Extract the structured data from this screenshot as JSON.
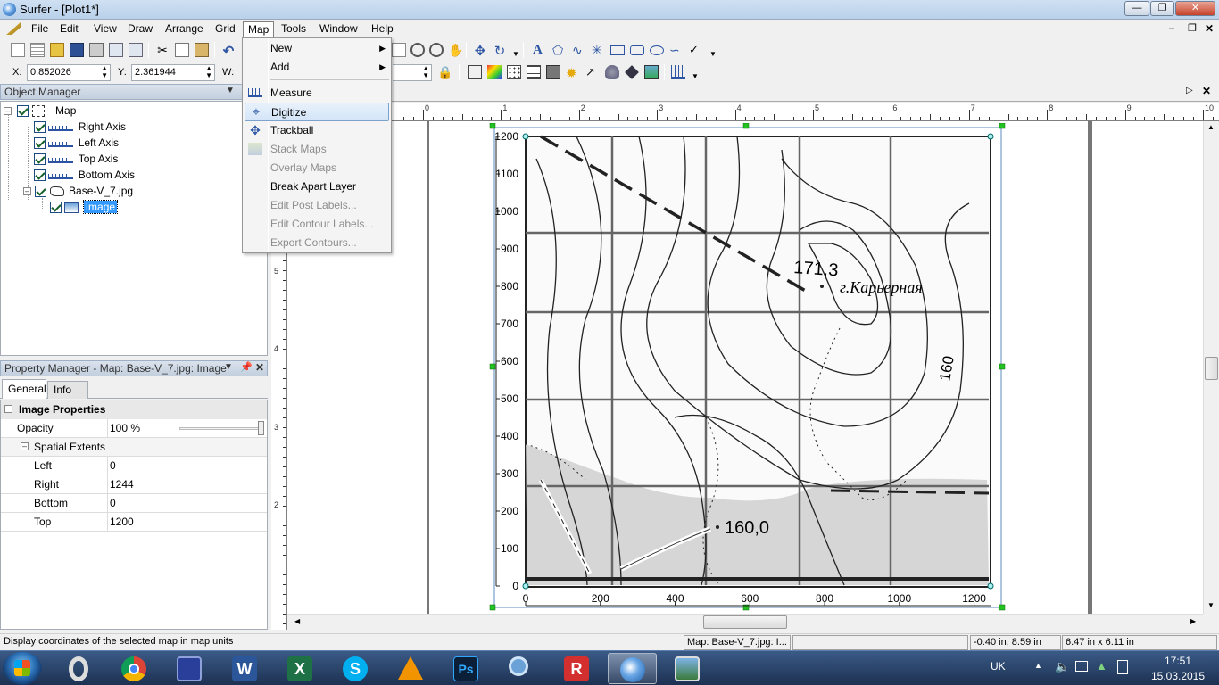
{
  "window": {
    "title": "Surfer - [Plot1*]"
  },
  "menubar": {
    "items": [
      "File",
      "Edit",
      "View",
      "Draw",
      "Arrange",
      "Grid",
      "Map",
      "Tools",
      "Window",
      "Help"
    ],
    "open": "Map"
  },
  "map_menu": {
    "items": [
      {
        "label": "New",
        "submenu": true,
        "enabled": true
      },
      {
        "label": "Add",
        "submenu": true,
        "enabled": true
      },
      {
        "label": "Measure",
        "enabled": true
      },
      {
        "label": "Digitize",
        "enabled": true,
        "highlighted": true
      },
      {
        "label": "Trackball",
        "enabled": true
      },
      {
        "label": "Stack Maps",
        "enabled": false
      },
      {
        "label": "Overlay Maps",
        "enabled": false
      },
      {
        "label": "Break Apart Layer",
        "enabled": true
      },
      {
        "label": "Edit Post Labels...",
        "enabled": false
      },
      {
        "label": "Edit Contour Labels...",
        "enabled": false
      },
      {
        "label": "Export Contours...",
        "enabled": false
      }
    ]
  },
  "coords": {
    "x_label": "X:",
    "x_value": "0.852026",
    "y_label": "Y:",
    "y_value": "2.361944",
    "w_label": "W:"
  },
  "object_manager": {
    "title": "Object Manager",
    "tree": [
      {
        "label": "Map",
        "level": 0,
        "icon": "map-icon"
      },
      {
        "label": "Right Axis",
        "level": 1,
        "icon": "axis-icon"
      },
      {
        "label": "Left Axis",
        "level": 1,
        "icon": "axis-icon"
      },
      {
        "label": "Top Axis",
        "level": 1,
        "icon": "axis-icon"
      },
      {
        "label": "Bottom Axis",
        "level": 1,
        "icon": "axis-icon"
      },
      {
        "label": "Base-V_7.jpg",
        "level": 1,
        "icon": "base-map-icon"
      },
      {
        "label": "Image",
        "level": 2,
        "icon": "image-icon",
        "selected": true
      }
    ]
  },
  "property_manager": {
    "title": "Property Manager - Map: Base-V_7.jpg: Image",
    "tabs": [
      "General",
      "Info"
    ],
    "section": "Image Properties",
    "opacity_label": "Opacity",
    "opacity_value": "100 %",
    "opacity_fraction": 1.0,
    "subsection": "Spatial Extents",
    "rows": [
      {
        "key": "Left",
        "value": "0"
      },
      {
        "key": "Right",
        "value": "1244"
      },
      {
        "key": "Bottom",
        "value": "0"
      },
      {
        "key": "Top",
        "value": "1200"
      }
    ]
  },
  "ruler": {
    "top_ticks": [
      "0",
      "1",
      "2",
      "3",
      "4",
      "5",
      "6",
      "7",
      "8",
      "9",
      "10"
    ],
    "left_ticks": [
      "6",
      "5",
      "4",
      "3",
      "2"
    ]
  },
  "plot": {
    "y_ticks": [
      "1200",
      "1100",
      "1000",
      "900",
      "800",
      "700",
      "600",
      "500",
      "400",
      "300",
      "200",
      "100",
      "0"
    ],
    "x_ticks": [
      "0",
      "200",
      "400",
      "600",
      "800",
      "1000",
      "1200"
    ],
    "map_labels": [
      "171,3",
      "г.Карьерная",
      "160",
      "160,0"
    ]
  },
  "statusbar": {
    "help": "Display coordinates of the selected map in map units",
    "selection": "Map: Base-V_7.jpg: I...",
    "position": "-0.40 in, 8.59 in",
    "size": "6.47 in x 6.11 in"
  },
  "taskbar": {
    "apps": [
      "Opera",
      "Chrome",
      "Save",
      "Word",
      "Excel",
      "Skype",
      "VLC",
      "Photoshop",
      "Search",
      "Reader",
      "Surfer",
      "Image Viewer"
    ],
    "lang": "UK",
    "time": "17:51",
    "date": "15.03.2015"
  },
  "colors": {
    "accent": "#3399ff",
    "selection": "#316ac5",
    "taskbar": "#1d3152"
  }
}
